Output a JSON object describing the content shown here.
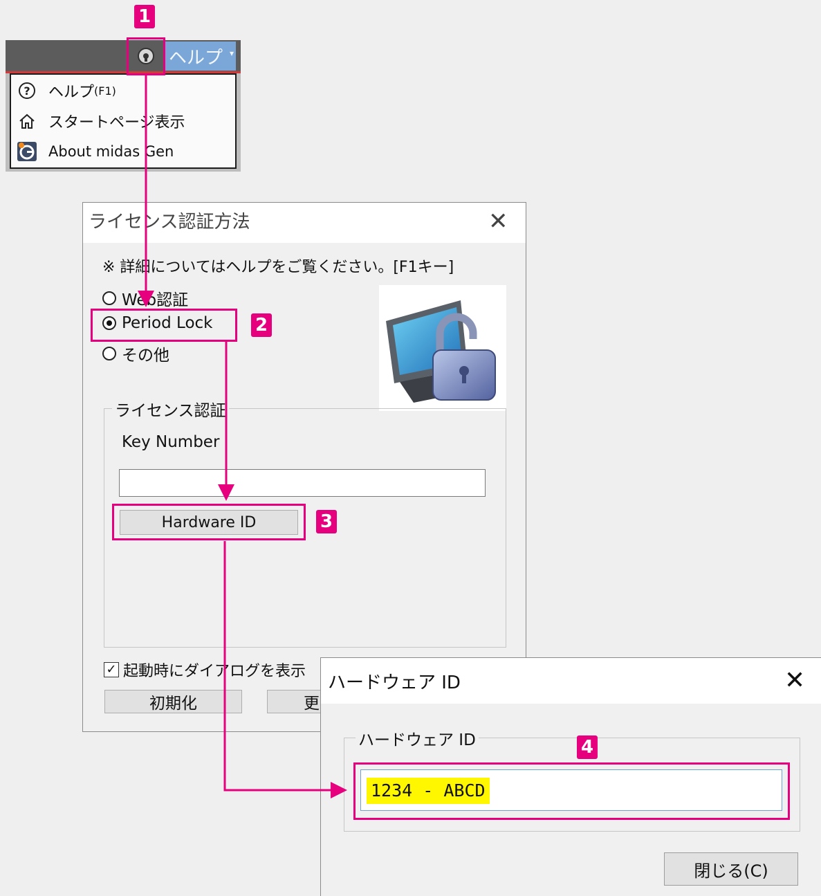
{
  "menu": {
    "help_label": "ヘルプ",
    "items": [
      {
        "icon": "question-circle-icon",
        "label": "ヘルプ",
        "shortcut": "(F1)"
      },
      {
        "icon": "home-icon",
        "label": "スタートページ表示"
      },
      {
        "icon": "midas-gen-logo-icon",
        "label": "About midas Gen"
      }
    ]
  },
  "license_dialog": {
    "title": "ライセンス認証方法",
    "close_label": "✕",
    "note": "※ 詳細についてはヘルプをご覧ください。[F1キー]",
    "radios": [
      {
        "label": "Web認証",
        "checked": false
      },
      {
        "label": "Period Lock",
        "checked": true
      },
      {
        "label": "その他",
        "checked": false
      }
    ],
    "group_title": "ライセンス認証",
    "key_label": "Key Number",
    "key_value": "",
    "hardware_button": "Hardware ID",
    "startup_checkbox": {
      "label": "起動時にダイアログを表示",
      "checked": true
    },
    "buttons": [
      "初期化",
      "更"
    ]
  },
  "hardware_dialog": {
    "title": "ハードウェア ID",
    "close_label": "✕",
    "group_title": "ハードウェア ID",
    "value": "1234 - ABCD",
    "close_button": "閉じる(C)"
  },
  "annotations": {
    "badges": [
      "1",
      "2",
      "3",
      "4"
    ],
    "color": "#e6007e"
  }
}
